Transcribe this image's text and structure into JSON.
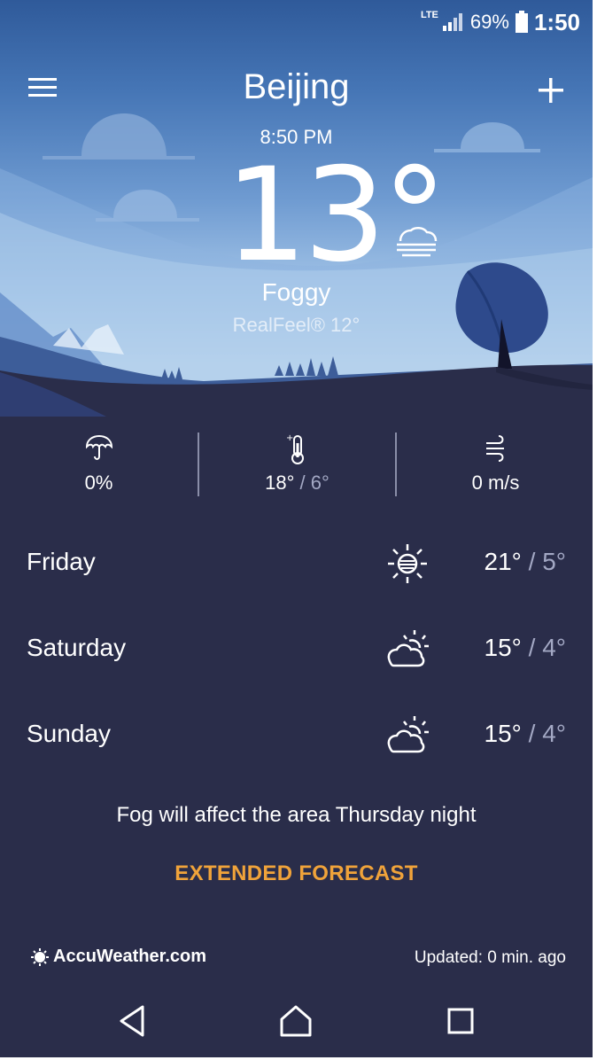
{
  "status_bar": {
    "network": "LTE",
    "battery_pct": "69%",
    "time": "1:50"
  },
  "header": {
    "city": "Beijing",
    "local_time": "8:50 PM",
    "menu_icon": "hamburger-menu-icon",
    "add_icon": "plus-icon"
  },
  "current": {
    "temperature": "13°",
    "condition_icon": "fog-icon",
    "condition": "Foggy",
    "realfeel": "RealFeel® 12°"
  },
  "stats": {
    "precip": {
      "icon": "umbrella-icon",
      "value": "0%"
    },
    "temp_range": {
      "icon": "thermometer-icon",
      "high": "18°",
      "separator": " / ",
      "low": "6°"
    },
    "wind": {
      "icon": "wind-icon",
      "value": "0 m/s"
    }
  },
  "forecast": [
    {
      "day": "Friday",
      "icon": "sunny-icon",
      "high": "21°",
      "separator": " / ",
      "low": "5°"
    },
    {
      "day": "Saturday",
      "icon": "partly-cloudy-icon",
      "high": "15°",
      "separator": " / ",
      "low": "4°"
    },
    {
      "day": "Sunday",
      "icon": "partly-cloudy-icon",
      "high": "15°",
      "separator": " / ",
      "low": "4°"
    }
  ],
  "summary": "Fog will affect the area Thursday night",
  "extended_forecast_label": "EXTENDED FORECAST",
  "footer": {
    "brand": "AccuWeather.com",
    "updated": "Updated: 0 min. ago"
  },
  "colors": {
    "accent": "#f0a33a",
    "panel": "#2a2d4a",
    "sky_top": "#2f5a9a",
    "secondary_text": "#a3a8c4"
  }
}
